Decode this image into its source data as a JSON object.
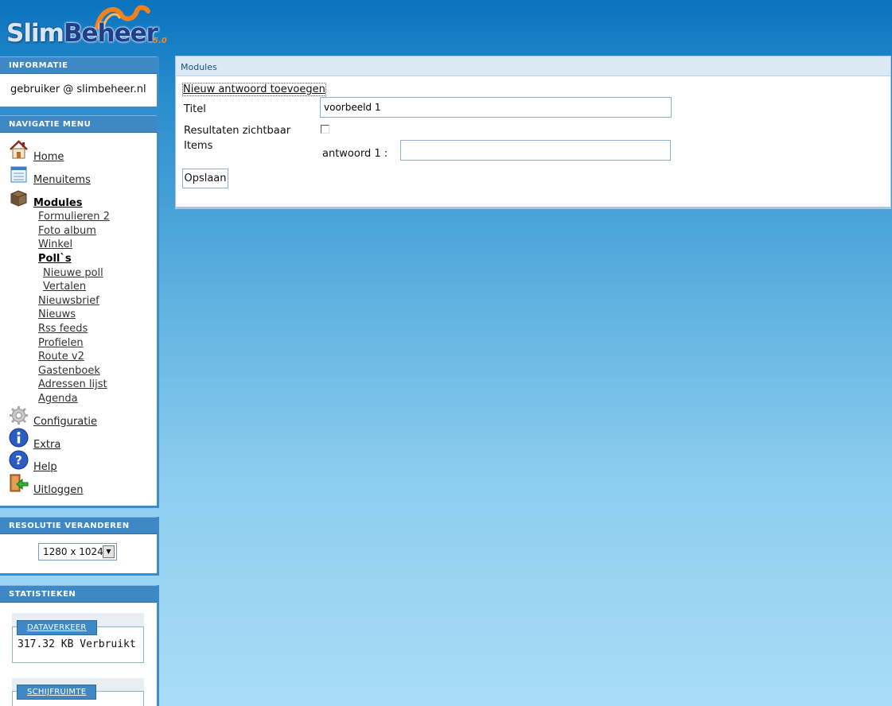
{
  "logo": {
    "brand_first": "Slim",
    "brand_second": "Beheer",
    "version": "5.0"
  },
  "colors": {
    "accent": "#3e88c6",
    "background_top": "#0a73be",
    "background_bottom": "#a9dcf6"
  },
  "panels": {
    "info": {
      "title": "INFORMATIE",
      "user": "gebruiker @ slimbeheer.nl"
    },
    "nav": {
      "title": "NAVIGATIE MENU"
    },
    "resolution": {
      "title": "RESOLUTIE VERANDEREN",
      "selected": "1280 x 1024"
    },
    "stats": {
      "title": "STATISTIEKEN"
    }
  },
  "nav": {
    "home": "Home",
    "menuitems": "Menuitems",
    "modules": "Modules",
    "sub": {
      "formulieren": "Formulieren 2",
      "foto": "Foto album",
      "winkel": "Winkel",
      "polls": "Poll`s",
      "nieuwe_poll": "Nieuwe poll",
      "vertalen": "Vertalen",
      "nieuwsbrief": "Nieuwsbrief",
      "nieuws": "Nieuws",
      "rss": "Rss feeds",
      "profielen": "Profielen",
      "route": "Route v2",
      "gastenboek": "Gastenboek",
      "adressen": "Adressen lijst",
      "agenda": "Agenda"
    },
    "configuratie": "Configuratie",
    "extra": "Extra",
    "help": "Help",
    "uitloggen": "Uitloggen"
  },
  "stats": {
    "dataverkeer": {
      "label": "DATAVERKEER",
      "value": "317.32 KB Verbruikt"
    },
    "schijfruimte": {
      "label": "SCHIJFRUIMTE"
    }
  },
  "content": {
    "breadcrumb": "Modules",
    "form_title": "Nieuw antwoord toevoegen",
    "titel_label": "Titel",
    "titel_value": "voorbeeld 1",
    "resultaten_label": "Resultaten zichtbaar",
    "items_label": "Items",
    "antwoord_label": "antwoord 1 :",
    "antwoord_value": "",
    "save_label": "Opslaan"
  }
}
